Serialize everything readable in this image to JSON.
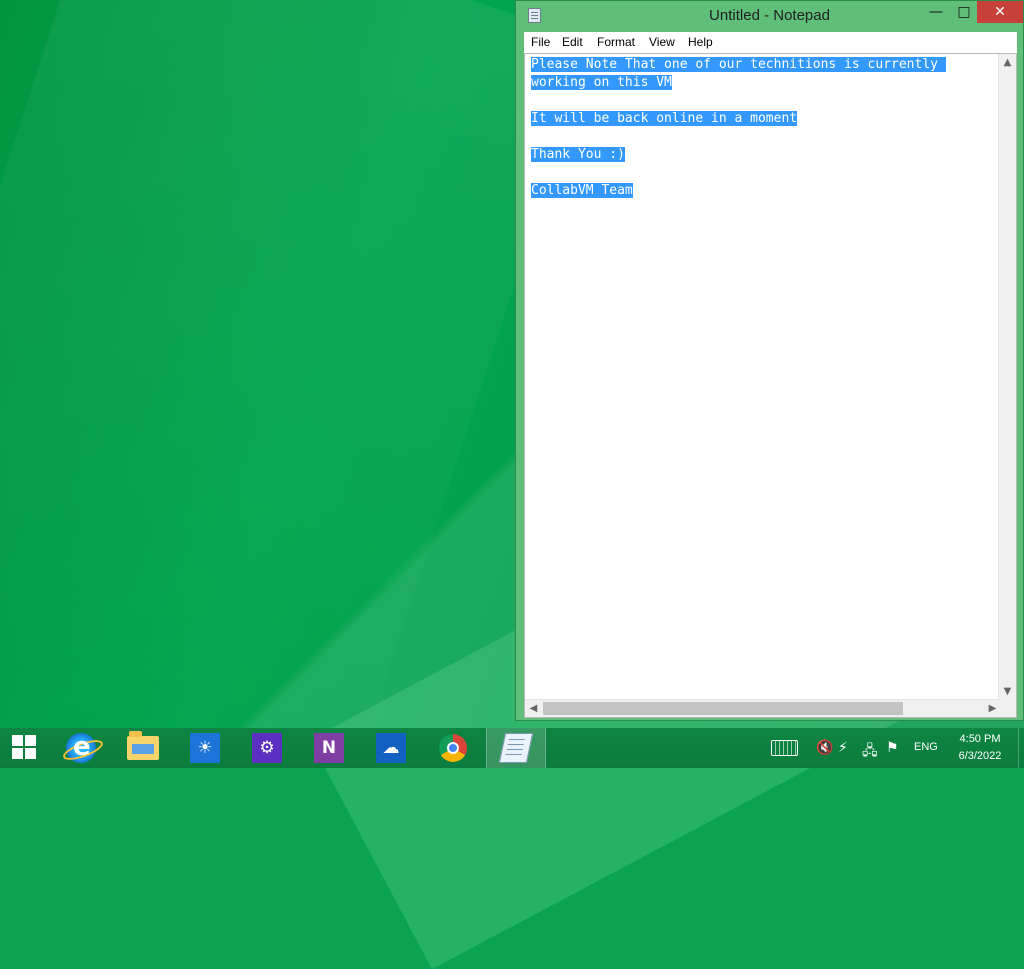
{
  "window": {
    "title": "Untitled - Notepad",
    "minimize_label": "—",
    "maximize_label": "□",
    "close_label": "✕"
  },
  "menu": {
    "file": "File",
    "edit": "Edit",
    "format": "Format",
    "view": "View",
    "help": "Help"
  },
  "document": {
    "lines": [
      "Please Note That one of our technitions is currently ",
      "working on this VM",
      "",
      "It will be back online in a moment",
      "",
      "Thank You :)",
      "",
      "CollabVM Team"
    ]
  },
  "taskbar": {
    "icons": [
      "internet-explorer-icon",
      "file-explorer-icon",
      "weather-app-icon",
      "settings-icon",
      "onenote-icon",
      "onedrive-icon",
      "chrome-icon",
      "notepad-icon"
    ],
    "onenote_letter": "N",
    "tray": {
      "language": "ENG",
      "time": "4:50 PM",
      "date": "6/3/2022"
    }
  },
  "colors": {
    "desktop": "#0aa451",
    "selection": "#3399ff",
    "close_button": "#c7413a",
    "window_frame": "#5fbf79"
  }
}
